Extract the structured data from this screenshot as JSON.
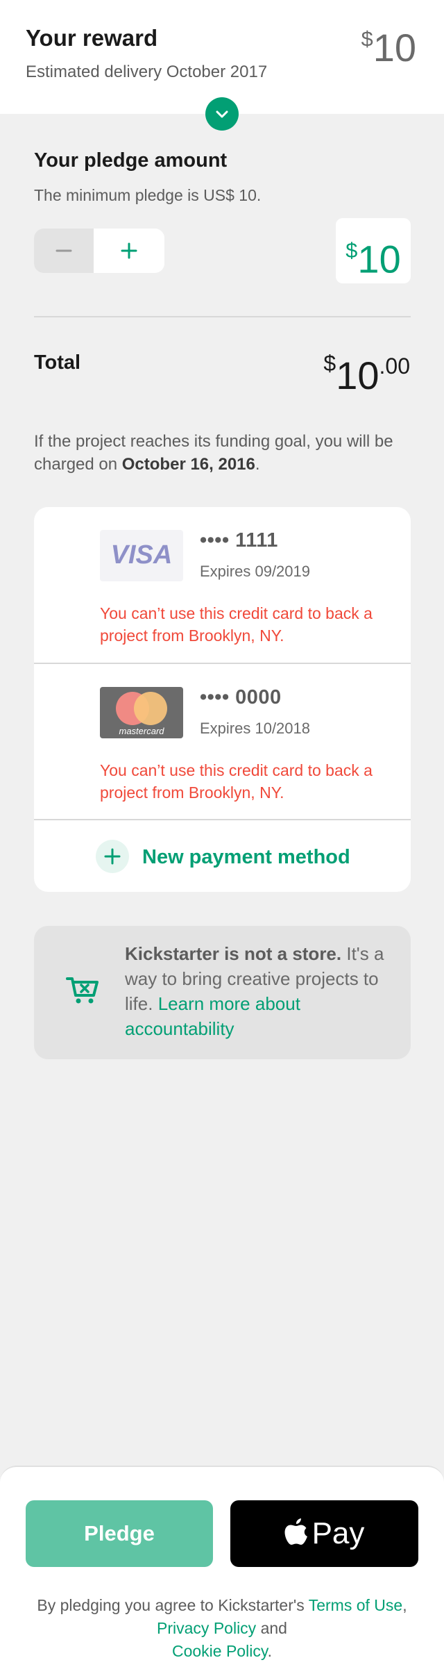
{
  "reward": {
    "title": "Your reward",
    "delivery": "Estimated delivery October 2017",
    "currency_symbol": "$",
    "amount": "10"
  },
  "pledge": {
    "title": "Your pledge amount",
    "minimum_note": "The minimum pledge is US$ 10.",
    "currency_symbol": "$",
    "amount": "10"
  },
  "total": {
    "label": "Total",
    "currency_symbol": "$",
    "amount": "10",
    "cents": ".00"
  },
  "charge_note": {
    "text": "If the project reaches its funding goal, you will be charged on ",
    "date": "October 16, 2016",
    "suffix": "."
  },
  "payment_methods": [
    {
      "brand": "VISA",
      "number": "•••• 1111",
      "expiry": "Expires 09/2019",
      "error": "You can’t use this credit card to back a project from Brooklyn, NY."
    },
    {
      "brand": "mastercard",
      "number": "•••• 0000",
      "expiry": "Expires 10/2018",
      "error": "You can’t use this credit card to back a project from Brooklyn, NY."
    }
  ],
  "new_payment_method": "New payment method",
  "store_note": {
    "bold": "Kickstarter is not a store.",
    "text": " It's a way to bring creative projects to life. ",
    "link": "Learn more about accountability"
  },
  "footer": {
    "pledge_button": "Pledge",
    "apple_pay_label": "Pay",
    "terms_prefix": "By pledging you agree to Kickstarter's ",
    "terms_link": "Terms of Use",
    "comma": ", ",
    "privacy_link": "Privacy Policy",
    "and": " and ",
    "cookie_link": "Cookie Policy",
    "period": "."
  },
  "colors": {
    "accent": "#029f74",
    "error": "#f0493a",
    "pledge_button": "#5fc4a4"
  },
  "icons": [
    "chevron-down-icon",
    "minus-icon",
    "plus-icon",
    "visa-logo",
    "mastercard-logo",
    "plus-icon",
    "cart-icon",
    "apple-logo-icon"
  ]
}
